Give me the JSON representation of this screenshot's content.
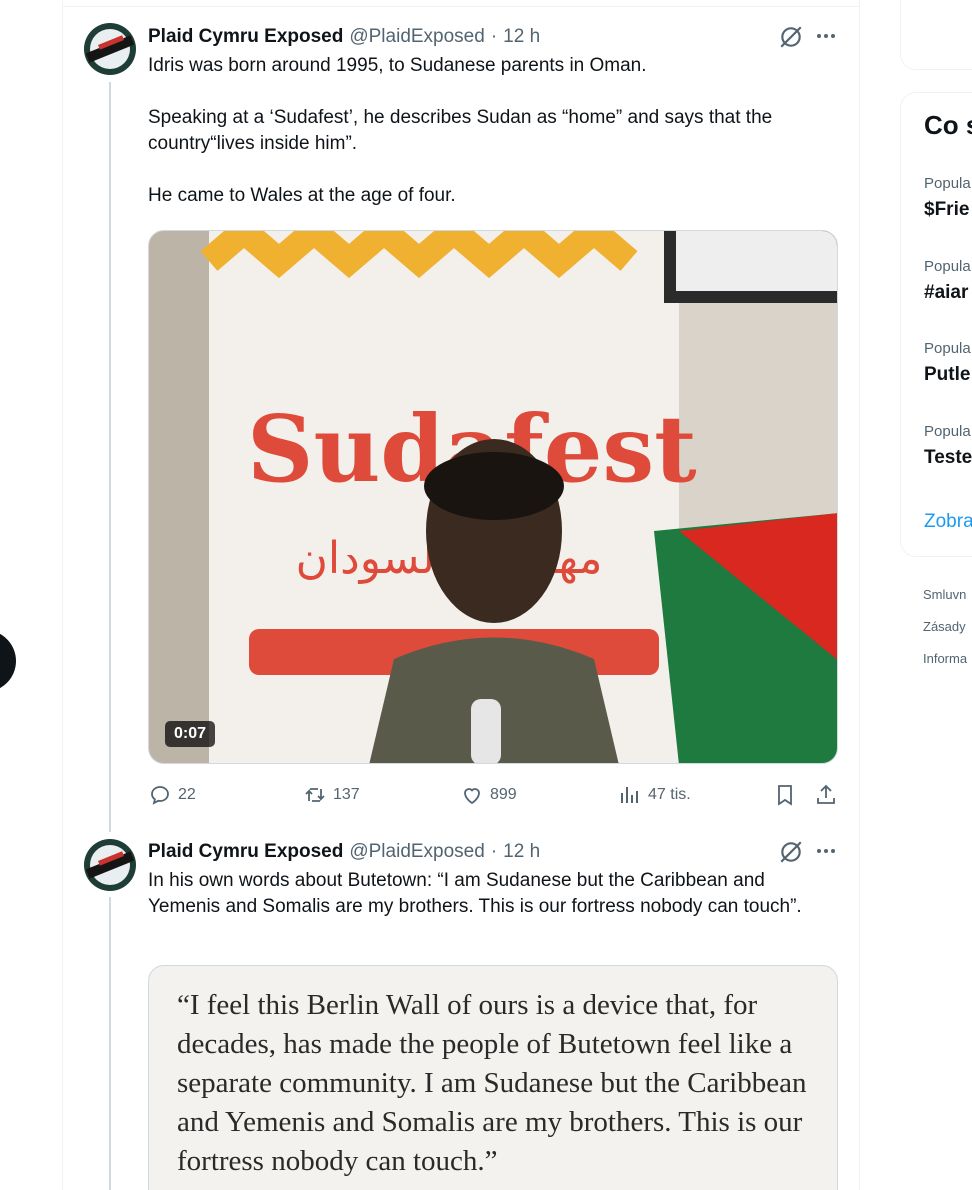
{
  "tweets": [
    {
      "author_name": "Plaid Cymru Exposed",
      "handle": "@PlaidExposed",
      "separator": "·",
      "time": "12 h",
      "paragraphs": [
        "Idris was born around 1995, to Sudanese parents in Oman.",
        "Speaking at a ‘Sudafest’, he describes Sudan as “home” and says that the country“lives inside him”.",
        "He came to Wales at the age of four."
      ],
      "media": {
        "banner_text": "Sudafest",
        "banner_arabic": "مهرجان السودان",
        "duration": "0:07"
      },
      "actions": {
        "replies": "22",
        "reposts": "137",
        "likes": "899",
        "views": "47 tis."
      }
    },
    {
      "author_name": "Plaid Cymru Exposed",
      "handle": "@PlaidExposed",
      "separator": "·",
      "time": "12 h",
      "paragraphs": [
        "In his own words about Butetown: “I am Sudanese but the Caribbean and Yemenis and Somalis are my brothers. This is our fortress nobody can touch”."
      ],
      "quote_image_text": "“I feel this Berlin Wall of ours is a device that, for decades, has made the people of Butetown feel like a separate community. I am Sudanese but the Caribbean and Yemenis and Somalis are my brothers. This is our fortress nobody can touch.”"
    }
  ],
  "sidebar": {
    "title": "Co s",
    "trends": [
      {
        "meta": "Popula",
        "name": "$Frie"
      },
      {
        "meta": "Popula",
        "name": "#aiar"
      },
      {
        "meta": "Popula",
        "name": "Putle"
      },
      {
        "meta": "Popula",
        "name": "Teste"
      }
    ],
    "show_more": "Zobra",
    "footer": [
      "Smluvn",
      "Zásady",
      "Informa"
    ]
  },
  "colors": {
    "text": "#0f1419",
    "muted": "#536471",
    "border": "#cfd9de",
    "accent": "#1d9bf0"
  }
}
